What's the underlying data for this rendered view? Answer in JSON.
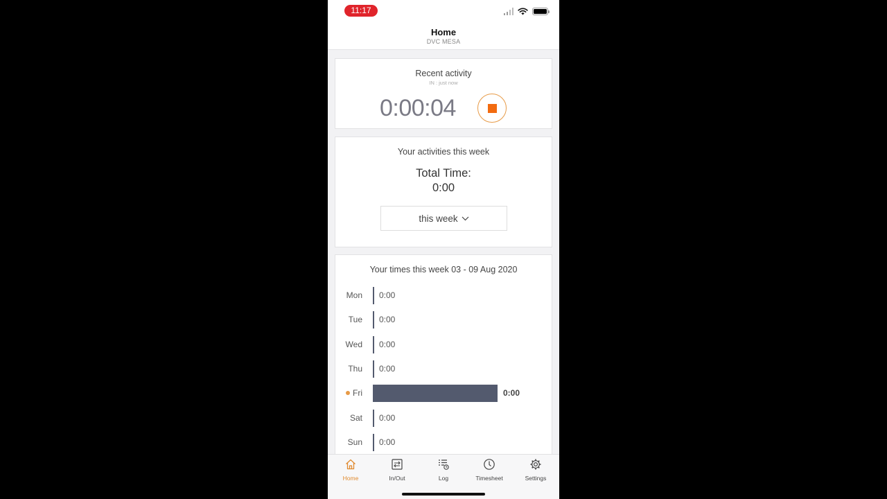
{
  "status_bar": {
    "time": "11:17"
  },
  "header": {
    "title": "Home",
    "subtitle": "DVC MESA"
  },
  "recent_activity": {
    "title": "Recent activity",
    "subtitle": "IN : just now",
    "timer": "0:00:04"
  },
  "week_activities": {
    "title": "Your activities this week",
    "total_label": "Total Time:",
    "total_value": "0:00",
    "period_selected": "this week"
  },
  "week_times": {
    "title": "Your times this week 03 - 09 Aug 2020",
    "days": [
      {
        "label": "Mon",
        "value": "0:00",
        "today": false,
        "bar_level": 0
      },
      {
        "label": "Tue",
        "value": "0:00",
        "today": false,
        "bar_level": 0
      },
      {
        "label": "Wed",
        "value": "0:00",
        "today": false,
        "bar_level": 0
      },
      {
        "label": "Thu",
        "value": "0:00",
        "today": false,
        "bar_level": 0
      },
      {
        "label": "Fri",
        "value": "0:00",
        "today": true,
        "bar_level": 1
      },
      {
        "label": "Sat",
        "value": "0:00",
        "today": false,
        "bar_level": 0
      },
      {
        "label": "Sun",
        "value": "0:00",
        "today": false,
        "bar_level": 0
      }
    ]
  },
  "tab_bar": {
    "tabs": [
      {
        "label": "Home",
        "icon": "home-icon",
        "active": true
      },
      {
        "label": "In/Out",
        "icon": "in-out-icon",
        "active": false
      },
      {
        "label": "Log",
        "icon": "log-icon",
        "active": false
      },
      {
        "label": "Timesheet",
        "icon": "clock-icon",
        "active": false
      },
      {
        "label": "Settings",
        "icon": "gear-icon",
        "active": false
      }
    ]
  },
  "colors": {
    "accent": "#e08a2e",
    "stop": "#f26b10",
    "bar": "#535a6e",
    "time_pill": "#e0242b"
  }
}
